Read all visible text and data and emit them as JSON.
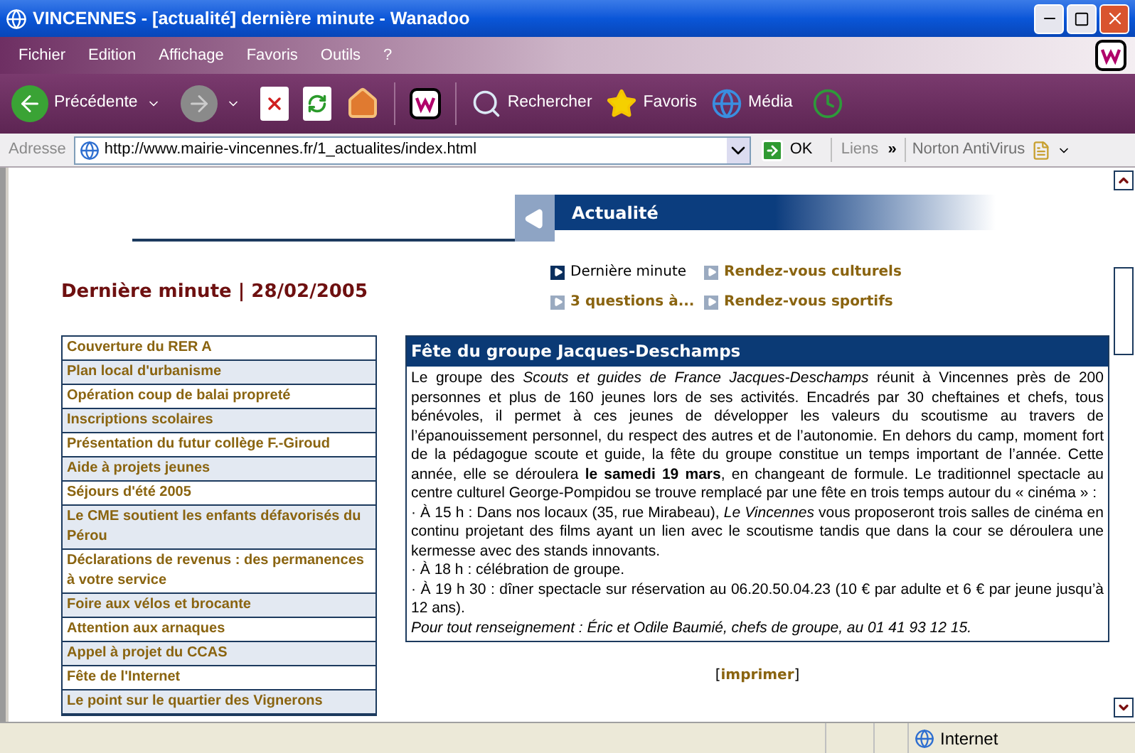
{
  "window": {
    "title": "VINCENNES - [actualité] dernière minute - Wanadoo"
  },
  "menu": [
    "Fichier",
    "Edition",
    "Affichage",
    "Favoris",
    "Outils",
    "?"
  ],
  "toolbar": {
    "back": "Précédente",
    "search": "Rechercher",
    "favorites": "Favoris",
    "media": "Média"
  },
  "address_bar": {
    "label": "Adresse",
    "url": "http://www.mairie-vincennes.fr/1_actualites/index.html",
    "go": "OK",
    "links": "Liens",
    "chevron": "»",
    "antivirus": "Norton AntiVirus"
  },
  "page": {
    "section_title": "Actualité",
    "heading": "Dernière minute | 28/02/2005",
    "subnav": [
      {
        "label": "Dernière minute",
        "selected": true
      },
      {
        "label": "Rendez-vous culturels",
        "selected": false
      },
      {
        "label": "3 questions à...",
        "selected": false
      },
      {
        "label": "Rendez-vous sportifs",
        "selected": false
      }
    ],
    "sidebar": [
      "Couverture du RER A",
      "Plan local d'urbanisme",
      "Opération coup de balai propreté",
      "Inscriptions scolaires",
      "Présentation du futur collège F.-Giroud",
      "Aide à projets jeunes",
      "Séjours d'été 2005",
      "Le CME soutient les enfants défavorisés du Pérou",
      "Déclarations de revenus : des permanences à votre service",
      "Foire aux vélos et brocante",
      "Attention aux arnaques",
      "Appel à projet du CCAS",
      "Fête de l'Internet",
      "Le point sur le quartier des Vignerons"
    ],
    "article": {
      "title": "Fête du groupe Jacques-Deschamps",
      "paragraphs": [
        {
          "kind": "text",
          "text": "Le groupe des *Scouts et guides de France Jacques-Deschamps* réunit à Vincennes près de 200 personnes et plus de 160 jeunes lors de ses activités. Encadrés par 30 cheftaines et chefs, tous bénévoles, il permet à ces jeunes de développer les valeurs du scoutisme au travers de l’épanouissement personnel, du respect des autres et de l’autonomie. En dehors du camp, moment fort de la pédagogue scoute et guide, la fête du groupe constitue un temps important de l’année. Cette année, elle se déroulera **le samedi 19 mars**, en changeant de formule. Le traditionnel spectacle au centre culturel George-Pompidou se trouve remplacé par une fête en trois temps autour du « cinéma » :"
        },
        {
          "kind": "text",
          "text": "· À 15 h : Dans nos locaux (35, rue Mirabeau), *Le Vincennes* vous proposeront trois salles de cinéma en continu projetant des films ayant un lien avec le scoutisme tandis que dans la cour se déroulera une kermesse avec des stands innovants."
        },
        {
          "kind": "text",
          "text": "· À 18 h : célébration de groupe."
        },
        {
          "kind": "text",
          "text": "· À 19 h 30 : dîner spectacle sur réservation au 06.20.50.04.23 (10 € par adulte et 6 € par jeune jusqu’à 12 ans)."
        },
        {
          "kind": "note",
          "text": "Pour tout renseignement : Éric et Odile Baumié, chefs de groupe, au 01 41 93 12 15."
        }
      ]
    },
    "print": {
      "open": "[",
      "label": "imprimer",
      "close": "]"
    }
  },
  "status_bar": {
    "zone": "Internet"
  }
}
